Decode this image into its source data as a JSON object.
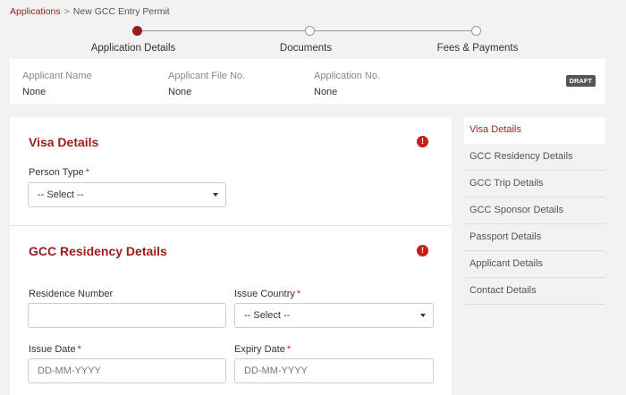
{
  "breadcrumb": {
    "root": "Applications",
    "separator": ">",
    "current": "New GCC Entry Permit"
  },
  "steps": [
    {
      "label": "Application Details",
      "active": true
    },
    {
      "label": "Documents",
      "active": false
    },
    {
      "label": "Fees & Payments",
      "active": false
    }
  ],
  "summary": {
    "applicant_name_label": "Applicant Name",
    "applicant_name": "None",
    "file_no_label": "Applicant File No.",
    "file_no": "None",
    "application_no_label": "Application No.",
    "application_no": "None",
    "status_badge": "DRAFT"
  },
  "visa_details": {
    "title": "Visa Details",
    "person_type_label": "Person Type",
    "person_type_value": "-- Select --"
  },
  "gcc_residency": {
    "title": "GCC Residency Details",
    "residence_number_label": "Residence Number",
    "residence_number_value": "",
    "issue_country_label": "Issue Country",
    "issue_country_value": "-- Select --",
    "issue_date_label": "Issue Date",
    "issue_date_placeholder": "DD-MM-YYYY",
    "expiry_date_label": "Expiry Date",
    "expiry_date_placeholder": "DD-MM-YYYY"
  },
  "required_mark": "*",
  "alert_symbol": "!",
  "side_nav": [
    {
      "label": "Visa Details",
      "active": true
    },
    {
      "label": "GCC Residency Details",
      "active": false
    },
    {
      "label": "GCC Trip Details",
      "active": false
    },
    {
      "label": "GCC Sponsor Details",
      "active": false
    },
    {
      "label": "Passport Details",
      "active": false
    },
    {
      "label": "Applicant Details",
      "active": false
    },
    {
      "label": "Contact Details",
      "active": false
    }
  ],
  "colors": {
    "accent": "#9b1c1c",
    "alert": "#c81d1d",
    "badge": "#555555"
  },
  "icons": {
    "alert": "exclamation-circle-icon",
    "dropdown": "caret-down-icon"
  }
}
